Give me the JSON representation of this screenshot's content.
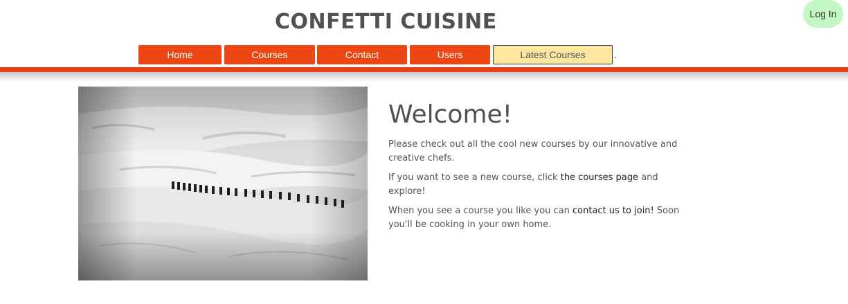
{
  "header": {
    "site_title": "CONFETTI CUISINE",
    "login_label": "Log In"
  },
  "nav": {
    "items": [
      {
        "label": "Home"
      },
      {
        "label": "Courses"
      },
      {
        "label": "Contact"
      },
      {
        "label": "Users"
      },
      {
        "label": "Latest Courses"
      }
    ],
    "trailing": "."
  },
  "main": {
    "heading": "Welcome!",
    "p1": "Please check out all the cool new courses by our innovative and creative chefs.",
    "p2_before": "If you want to see a new course, click ",
    "p2_link": "the courses page",
    "p2_after": " and explore!",
    "p3_before": "When you see a course you like you can ",
    "p3_link": "contact us to join!",
    "p3_after": " Soon you'll be cooking in your own home."
  },
  "colors": {
    "nav_bg": "#ee4612",
    "nav_alt_bg": "#fde69e",
    "login_bg": "#c3f7c3",
    "accent_bar": "#ee3f16"
  }
}
